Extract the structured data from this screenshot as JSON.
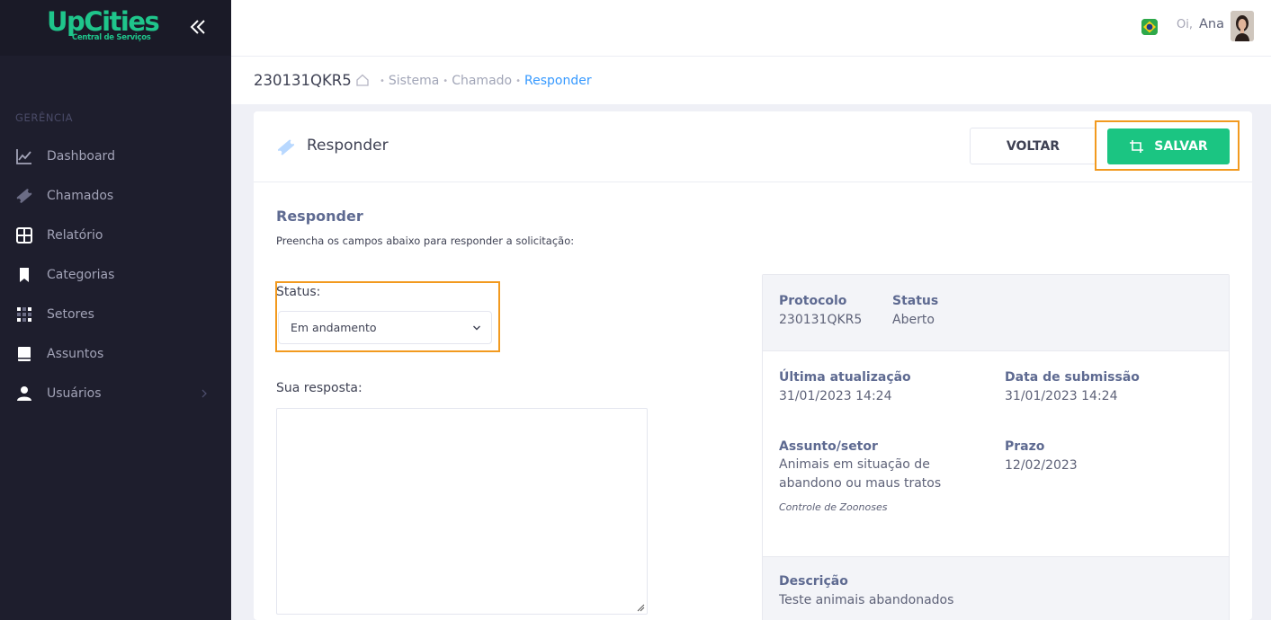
{
  "brand": {
    "name": "UpCities",
    "tagline": "Central de Serviços"
  },
  "sidebar": {
    "section": "GERÊNCIA",
    "items": [
      {
        "label": "Dashboard",
        "icon": "chart-line-icon"
      },
      {
        "label": "Chamados",
        "icon": "ticket-icon"
      },
      {
        "label": "Relatório",
        "icon": "grid-icon"
      },
      {
        "label": "Categorias",
        "icon": "bookmark-icon"
      },
      {
        "label": "Setores",
        "icon": "dots-grid-icon"
      },
      {
        "label": "Assuntos",
        "icon": "book-icon"
      },
      {
        "label": "Usuários",
        "icon": "user-icon",
        "has_submenu": true
      }
    ]
  },
  "header": {
    "greeting": "Oi,",
    "user_name": "Ana",
    "language": "Brazil flag"
  },
  "subheader": {
    "ticket_id": "230131QKR5",
    "breadcrumb": [
      "Sistema",
      "Chamado",
      "Responder"
    ]
  },
  "card": {
    "title": "Responder",
    "back_label": "VOLTAR",
    "save_label": "SALVAR"
  },
  "form": {
    "title": "Responder",
    "description": "Preencha os campos abaixo para responder a solicitação:",
    "status_label": "Status:",
    "status_value": "Em andamento",
    "answer_label": "Sua resposta:",
    "answer_value": ""
  },
  "info": {
    "protocolo_label": "Protocolo",
    "protocolo_value": "230131QKR5",
    "status_label": "Status",
    "status_value": "Aberto",
    "ultima_label": "Última atualização",
    "ultima_value": "31/01/2023 14:24",
    "submissao_label": "Data de submissão",
    "submissao_value": "31/01/2023 14:24",
    "assunto_label": "Assunto/setor",
    "assunto_value": "Animais em situação de abandono ou maus tratos",
    "setor_value": "Controle de Zoonoses",
    "prazo_label": "Prazo",
    "prazo_value": "12/02/2023",
    "descricao_label": "Descrição",
    "descricao_value": "Teste animais abandonados"
  },
  "colors": {
    "sidebar_bg": "#1e1e2d",
    "brand_green": "#1fc58b",
    "save_green": "#1bc582",
    "link_blue": "#3699ff",
    "highlight_orange": "#f29a1f"
  }
}
